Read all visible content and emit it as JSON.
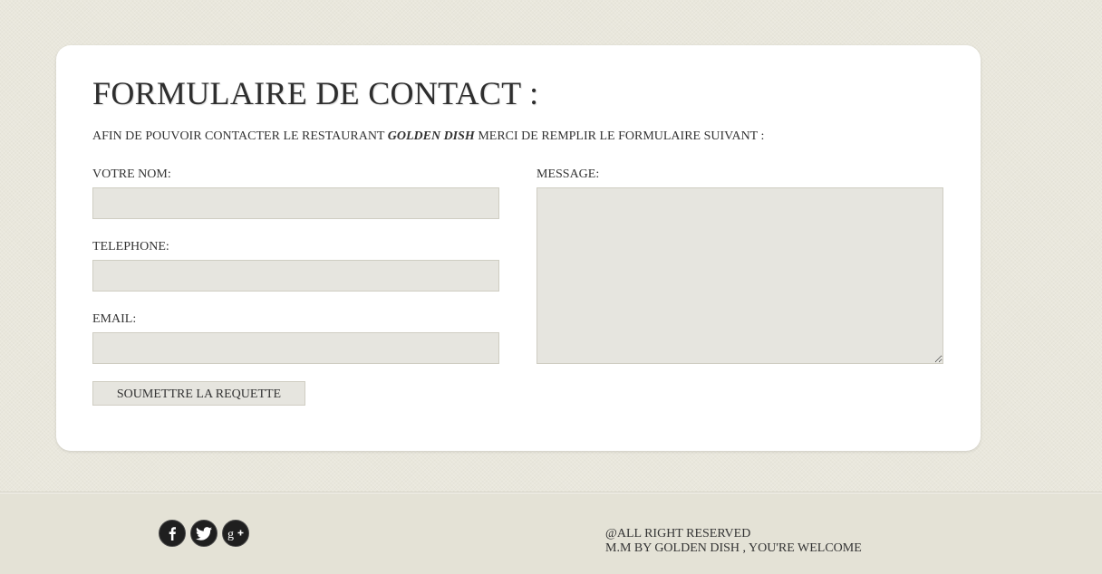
{
  "form": {
    "title": "FORMULAIRE DE CONTACT :",
    "intro_before": "AFIN DE POUVOIR CONTACTER LE RESTAURANT ",
    "intro_brand": "GOLDEN DISH",
    "intro_after": " MERCI DE REMPLIR LE FORMULAIRE SUIVANT :",
    "name_label": "VOTRE NOM:",
    "name_value": "",
    "phone_label": "TELEPHONE:",
    "phone_value": "",
    "email_label": "EMAIL:",
    "email_value": "",
    "message_label": "MESSAGE:",
    "message_value": "",
    "submit_label": "SOUMETTRE LA REQUETTE"
  },
  "footer": {
    "social": [
      {
        "icon": "facebook-icon",
        "glyph": "f"
      },
      {
        "icon": "twitter-icon",
        "glyph": "twitter bird"
      },
      {
        "icon": "google-plus-icon",
        "glyph": "g+"
      }
    ],
    "copyright": "@ALL RIGHT RESERVED",
    "credit": "M.M BY GOLDEN DISH , YOU'RE WELCOME"
  },
  "colors": {
    "page_background": "#e9e7dc",
    "card_background": "#ffffff",
    "field_background": "#e6e5df",
    "social_icon_background": "#1f1f1f"
  }
}
